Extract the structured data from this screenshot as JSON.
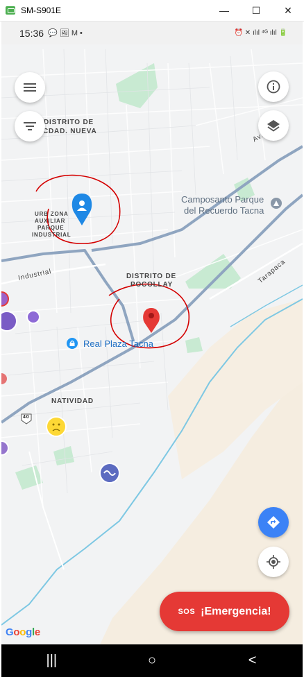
{
  "window": {
    "title": "SM-S901E",
    "minimize": "—",
    "maximize": "☐",
    "close": "✕"
  },
  "statusbar": {
    "time": "15:36",
    "left_icons": "💬 🖼 M •",
    "right_icons": "⏰ ✕ ılıl ⁴ᴳ ılıl 🔋"
  },
  "map": {
    "labels": {
      "distrito_nueva_1": "DISTRITO DE",
      "distrito_nueva_2": "CDAD. NUEVA",
      "urb_zona_1": "URB ZONA",
      "urb_zona_2": "AUXILIAR",
      "urb_zona_3": "PARQUE",
      "urb_zona_4": "INDUSTRIAL",
      "pocollay_1": "DISTRITO DE",
      "pocollay_2": "POCOLLAY",
      "natividad": "NATIVIDAD",
      "industrial": "Industrial",
      "tarapaca": "Tarapaca",
      "av": "Av.",
      "route40": "40"
    },
    "pois": {
      "camposanto_1": "Camposanto Parque",
      "camposanto_2": "del Recuerdo Tacna",
      "real_plaza": "Real Plaza Tacna"
    },
    "colors": {
      "water": "#7ec8e3",
      "road_main": "#8fa5c0",
      "park": "#c8ead2",
      "sand": "#f5ede0",
      "sos": "#e53935",
      "fab_blue": "#3b82f6"
    }
  },
  "controls": {
    "menu_icon": "menu-icon",
    "filter_icon": "filter-icon",
    "info_icon": "info-icon",
    "layers_icon": "layers-icon",
    "directions_icon": "directions-icon",
    "locate_icon": "my-location-icon"
  },
  "sos": {
    "badge": "SOS",
    "label": "¡Emergencia!"
  },
  "google_logo": "Google",
  "navbar": {
    "recent": "|||",
    "home": "○",
    "back": "<"
  }
}
